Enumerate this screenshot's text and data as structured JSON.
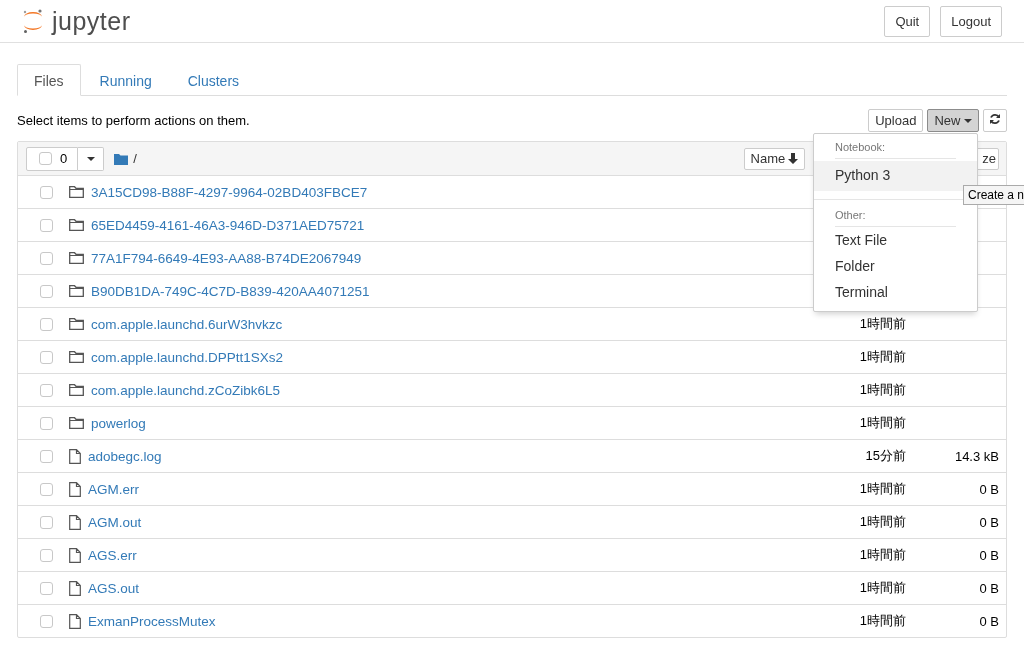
{
  "header": {
    "logo_text": "jupyter",
    "buttons": [
      "Quit",
      "Logout"
    ]
  },
  "tabs": [
    {
      "label": "Files",
      "selected": true
    },
    {
      "label": "Running",
      "selected": false
    },
    {
      "label": "Clusters",
      "selected": false
    }
  ],
  "toolbar": {
    "hint": "Select items to perform actions on them.",
    "upload": "Upload",
    "new": "New",
    "new_open": true
  },
  "list_header": {
    "checked": false,
    "count": "0",
    "path": "/",
    "sort_name": "Name",
    "sort_size": "ze"
  },
  "rows": [
    {
      "kind": "folder",
      "name": "3A15CD98-B88F-4297-9964-02BD403FBCE7",
      "checked": false
    },
    {
      "kind": "folder",
      "name": "65ED4459-4161-46A3-946D-D371AED75721",
      "checked": false
    },
    {
      "kind": "folder",
      "name": "77A1F794-6649-4E93-AA88-B74DE2067949",
      "checked": false
    },
    {
      "kind": "folder",
      "name": "B90DB1DA-749C-4C7D-B839-420AA4071251",
      "checked": false
    },
    {
      "kind": "folder",
      "name": "com.apple.launchd.6urW3hvkzc",
      "checked": false,
      "modified": "1時間前"
    },
    {
      "kind": "folder",
      "name": "com.apple.launchd.DPPtt1SXs2",
      "checked": false,
      "modified": "1時間前"
    },
    {
      "kind": "folder",
      "name": "com.apple.launchd.zCoZibk6L5",
      "checked": false,
      "modified": "1時間前"
    },
    {
      "kind": "folder",
      "name": "powerlog",
      "checked": false,
      "modified": "1時間前"
    },
    {
      "kind": "file",
      "name": "adobegc.log",
      "checked": false,
      "modified": "15分前",
      "size": "14.3 kB"
    },
    {
      "kind": "file",
      "name": "AGM.err",
      "checked": false,
      "modified": "1時間前",
      "size": "0 B"
    },
    {
      "kind": "file",
      "name": "AGM.out",
      "checked": false,
      "modified": "1時間前",
      "size": "0 B"
    },
    {
      "kind": "file",
      "name": "AGS.err",
      "checked": false,
      "modified": "1時間前",
      "size": "0 B"
    },
    {
      "kind": "file",
      "name": "AGS.out",
      "checked": false,
      "modified": "1時間前",
      "size": "0 B"
    },
    {
      "kind": "file",
      "name": "ExmanProcessMutex",
      "checked": false,
      "modified": "1時間前",
      "size": "0 B"
    }
  ],
  "new_menu": {
    "sections": [
      {
        "heading": "Notebook:",
        "items": [
          {
            "label": "Python 3",
            "selected": true
          }
        ]
      },
      {
        "heading": "Other:",
        "items": [
          {
            "label": "Text File",
            "selected": false
          },
          {
            "label": "Folder",
            "selected": false
          },
          {
            "label": "Terminal",
            "selected": false
          }
        ]
      }
    ]
  },
  "tooltip": "Create a n"
}
